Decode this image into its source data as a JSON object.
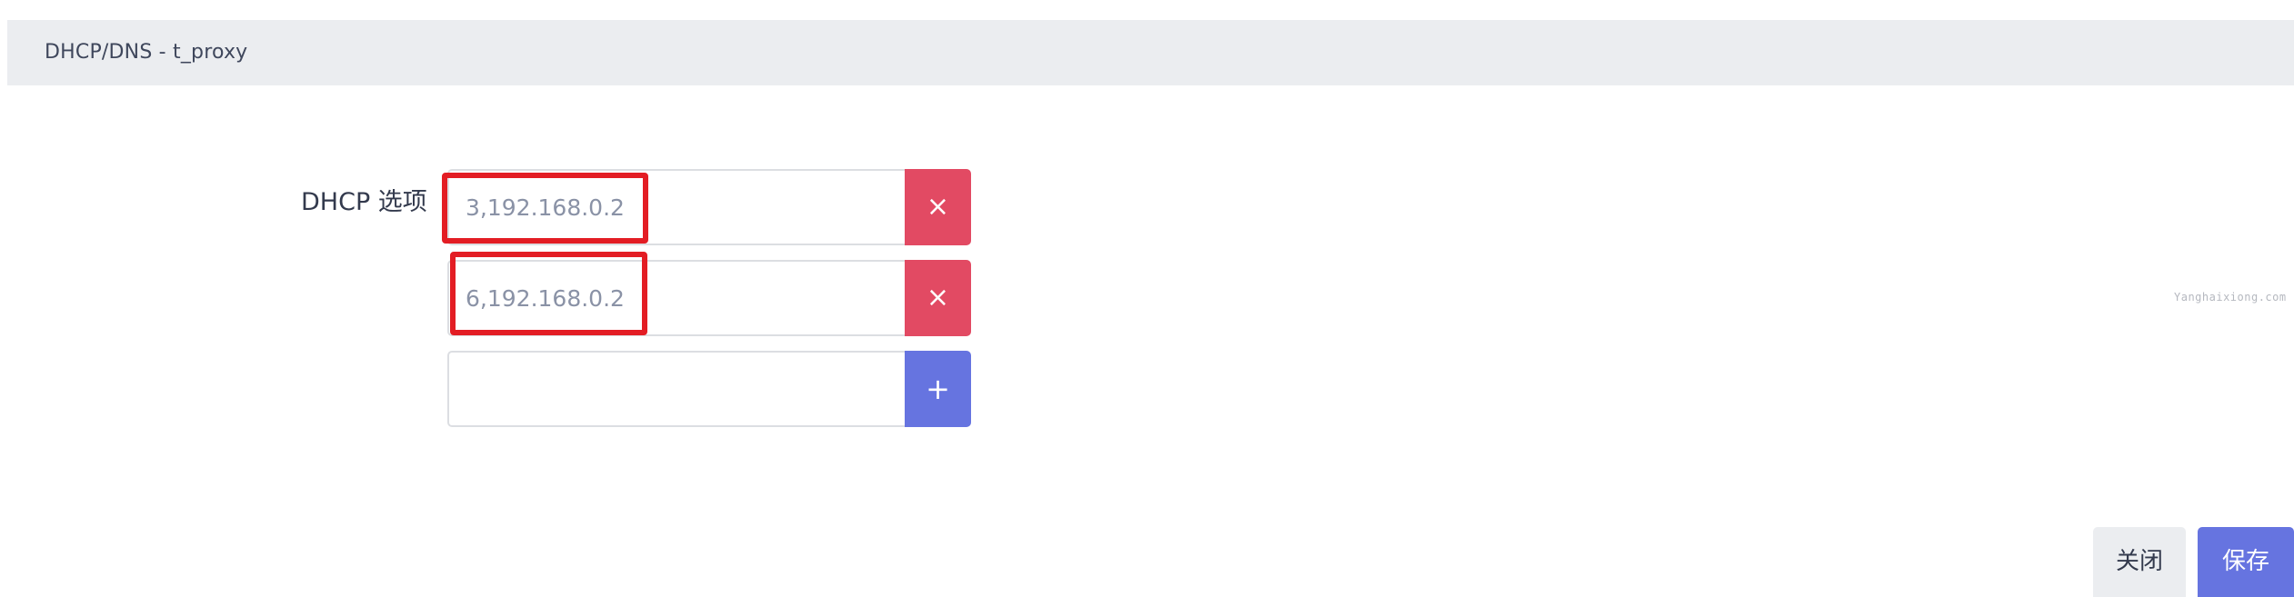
{
  "title": "DHCP/DNS - t_proxy",
  "form": {
    "dhcp_options": {
      "label": "DHCP 选项",
      "entries": [
        {
          "value": "3,192.168.0.2",
          "button": "×"
        },
        {
          "value": "6,192.168.0.2",
          "button": "×"
        }
      ],
      "new_entry": {
        "value": "",
        "button": "+"
      }
    }
  },
  "watermark": "Yanghaixiong.com",
  "footer": {
    "close_label": "关闭",
    "save_label": "保存"
  },
  "colors": {
    "remove_button": "#e24a63",
    "add_button": "#6674e0",
    "save_button": "#6674e0",
    "highlight": "#e31d24",
    "title_bar": "#ebedf0"
  },
  "icons": {
    "remove": "close-icon",
    "add": "plus-icon"
  }
}
